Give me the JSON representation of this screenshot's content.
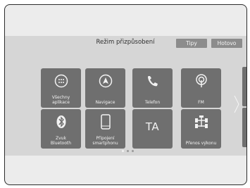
{
  "header": {
    "title": "Režim přizpůsobení",
    "tips_label": "Tipy",
    "done_label": "Hotovo"
  },
  "tiles": [
    {
      "label": "Všechny\naplikace",
      "icon": "apps-grid-icon"
    },
    {
      "label": "Navigace",
      "icon": "navigation-arrow-icon"
    },
    {
      "label": "Telefon",
      "icon": "phone-icon"
    },
    {
      "label": "FM",
      "icon": "radio-antenna-icon"
    },
    {
      "label": "Zvuk\nBluetooth",
      "icon": "bluetooth-icon"
    },
    {
      "label": "Připojení\nsmartphonu",
      "icon": "smartphone-icon"
    },
    {
      "label": "TA",
      "icon": ""
    },
    {
      "label": "Přenos výkonu",
      "icon": "drivetrain-icon"
    }
  ],
  "pager": {
    "count": 3,
    "active": 1
  },
  "colors": {
    "tile": "#6f6f6f",
    "screen": "#d6d6d6",
    "pill": "#8c8c8c"
  }
}
